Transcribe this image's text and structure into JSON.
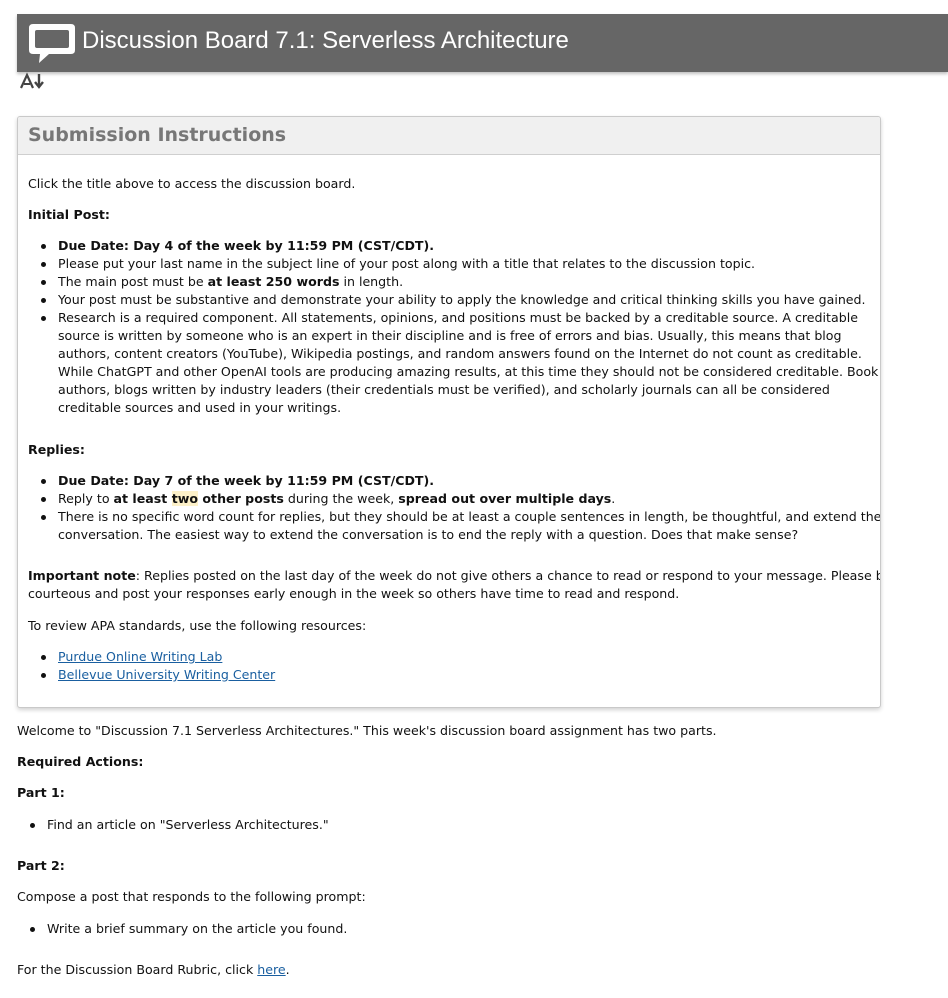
{
  "header": {
    "title": "Discussion Board 7.1: Serverless Architecture",
    "icon": "speech-bubble-icon",
    "bar_color": "#666666"
  },
  "toolbar": {
    "font_size_icon": "text-size-icon"
  },
  "instructions": {
    "title": "Submission Instructions",
    "intro": "Click the title above to access the discussion board.",
    "initial_post_heading": "Initial Post:",
    "initial_post_items": {
      "due": "Due Date: Day 4 of the week by 11:59 PM (CST/CDT).",
      "last_name": "Please put your last name in the subject line of your post along with a title that relates to the discussion topic.",
      "words_pre": "The main post must be ",
      "words_bold": "at least 250 words",
      "words_post": " in length.",
      "substantive": "Your post must be substantive and demonstrate your ability to apply the knowledge and critical thinking skills you have gained.",
      "research_lines": [
        "Research is a required component.  All statements, opinions, and positions must be backed by a creditable source.  A creditable",
        "source is written by someone who is an expert in their discipline and is free of errors and bias.  Usually, this means that blog",
        "authors, content creators (YouTube), Wikipedia postings, and random answers found on the Internet do not count as creditable.",
        "While ChatGPT and other OpenAI tools are producing amazing results, at this time they should not be considered creditable.  Book",
        "authors, blogs written by industry leaders (their credentials must be verified), and scholarly journals can all be considered",
        "creditable sources and used in your writings."
      ]
    },
    "replies_heading": "Replies:",
    "replies_items": {
      "due": "Due Date: Day 7 of the week by 11:59 PM (CST/CDT).",
      "reply_a": "Reply to ",
      "reply_b": "at least ",
      "reply_c": "two",
      "reply_d": " other posts",
      "reply_e": " during the week, ",
      "reply_f": "spread out over multiple days",
      "reply_g": ".",
      "word_count_lines": [
        "There is no specific word count for replies, but they should be at least a couple sentences in length, be thoughtful, and extend the",
        "conversation.  The easiest way to extend the conversation is to end the reply with a question.  Does that make sense?"
      ]
    },
    "important_label": "Important note",
    "important_lines": [
      ": Replies posted on the last day of the week do not give others a chance to read or respond to your message.  Please be",
      "courteous and post your responses early enough in the week so others have time to read and respond."
    ],
    "apa_text": "To review APA standards, use the following resources:",
    "links": [
      "Purdue Online Writing Lab",
      "Bellevue University Writing Center"
    ]
  },
  "main": {
    "welcome": "Welcome to \"Discussion 7.1 Serverless Architectures.\"  This week's discussion board assignment has two parts.",
    "required_actions": "Required Actions:",
    "part1_heading": "Part 1:",
    "part1_item": "Find an article on \"Serverless Architectures.\"",
    "part2_heading": "Part 2:",
    "part2_prompt": "Compose a post that responds to the following prompt:",
    "part2_item": "Write a brief summary on the article you found.",
    "rubric_pre": "For the Discussion Board Rubric, click ",
    "rubric_link": "here",
    "rubric_post": "."
  }
}
